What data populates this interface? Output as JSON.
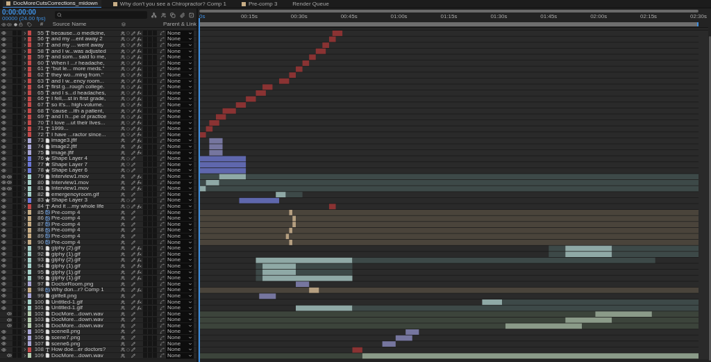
{
  "tabs": [
    {
      "label": "DocMoreCutsCorrections_midown",
      "selected": true
    },
    {
      "label": "Why don't you see a Chiropractor? Comp 1",
      "selected": false
    },
    {
      "label": "Pre-comp 3",
      "selected": false
    },
    {
      "label": "Render Queue",
      "selected": false
    }
  ],
  "timecode": "0:00:00:00",
  "frame_info": "00000 (24.00 fps)",
  "columns": {
    "number": "#",
    "name": "Source Name",
    "parent": "Parent & Link"
  },
  "ruler": [
    "0s",
    "00:15s",
    "00:30s",
    "00:45s",
    "01:00s",
    "01:15s",
    "01:30s",
    "01:45s",
    "02:00s",
    "02:15s",
    "02:30s"
  ],
  "layers": [
    {
      "num": "55",
      "name": "because...o medicine,",
      "kind": "text",
      "color": "#c44a4a",
      "video": true,
      "audio": false,
      "fx": true,
      "parent": "None"
    },
    {
      "num": "56",
      "name": "and my ...ent away 2",
      "kind": "text",
      "color": "#c44a4a",
      "video": true,
      "audio": false,
      "fx": true,
      "parent": "None"
    },
    {
      "num": "57",
      "name": "and my ... went away",
      "kind": "text",
      "color": "#c44a4a",
      "video": true,
      "audio": false,
      "fx": true,
      "parent": "None"
    },
    {
      "num": "58",
      "name": "and I w...was adjusted",
      "kind": "text",
      "color": "#c44a4a",
      "video": true,
      "audio": false,
      "fx": true,
      "parent": "None"
    },
    {
      "num": "59",
      "name": "and som... said to me,",
      "kind": "text",
      "color": "#c44a4a",
      "video": true,
      "audio": false,
      "fx": true,
      "parent": "None"
    },
    {
      "num": "60",
      "name": "When I ...r headache,",
      "kind": "text",
      "color": "#c44a4a",
      "video": true,
      "audio": false,
      "fx": true,
      "parent": "None"
    },
    {
      "num": "61",
      "name": "\"but le... more meds.\"",
      "kind": "text",
      "color": "#c44a4a",
      "video": true,
      "audio": false,
      "fx": true,
      "parent": "None"
    },
    {
      "num": "62",
      "name": "they wo...ming from.\"",
      "kind": "text",
      "color": "#c44a4a",
      "video": true,
      "audio": false,
      "fx": true,
      "parent": "None"
    },
    {
      "num": "63",
      "name": "and I w...ency room...",
      "kind": "text",
      "color": "#c44a4a",
      "video": true,
      "audio": false,
      "fx": true,
      "parent": "None"
    },
    {
      "num": "64",
      "name": "first g...rough college.",
      "kind": "text",
      "color": "#c44a4a",
      "video": true,
      "audio": false,
      "fx": true,
      "parent": "None"
    },
    {
      "num": "65",
      "name": "and I s...d headaches,",
      "kind": "text",
      "color": "#c44a4a",
      "video": true,
      "audio": false,
      "fx": true,
      "parent": "None"
    },
    {
      "num": "66",
      "name": "I fell,...st in first grade,",
      "kind": "text",
      "color": "#c44a4a",
      "video": true,
      "audio": false,
      "fx": true,
      "parent": "None"
    },
    {
      "num": "67",
      "name": "so it's... high-volume.",
      "kind": "text",
      "color": "#c44a4a",
      "video": true,
      "audio": false,
      "fx": true,
      "parent": "None"
    },
    {
      "num": "68",
      "name": "'cause ...ith a patient,",
      "kind": "text",
      "color": "#c44a4a",
      "video": true,
      "audio": false,
      "fx": true,
      "parent": "None"
    },
    {
      "num": "69",
      "name": "and I h...pe of practice",
      "kind": "text",
      "color": "#c44a4a",
      "video": true,
      "audio": false,
      "fx": true,
      "parent": "None"
    },
    {
      "num": "70",
      "name": "I love ...ut their lives...",
      "kind": "text",
      "color": "#c44a4a",
      "video": true,
      "audio": false,
      "fx": true,
      "parent": "None"
    },
    {
      "num": "71",
      "name": "1999...",
      "kind": "text",
      "color": "#c44a4a",
      "video": true,
      "audio": false,
      "fx": true,
      "parent": "None"
    },
    {
      "num": "72",
      "name": "I have ...ractor since...",
      "kind": "text",
      "color": "#c44a4a",
      "video": true,
      "audio": false,
      "fx": true,
      "parent": "None"
    },
    {
      "num": "73",
      "name": "image3.jfif",
      "kind": "image",
      "color": "#a9a6d6",
      "video": true,
      "audio": false,
      "fx": true,
      "parent": "None"
    },
    {
      "num": "74",
      "name": "image2.jfif",
      "kind": "image",
      "color": "#a9a6d6",
      "video": true,
      "audio": false,
      "fx": true,
      "parent": "None"
    },
    {
      "num": "75",
      "name": "image.jfif",
      "kind": "image",
      "color": "#a9a6d6",
      "video": true,
      "audio": false,
      "fx": true,
      "parent": "None"
    },
    {
      "num": "76",
      "name": "Shape Layer 4",
      "kind": "shape",
      "color": "#6c79d8",
      "video": true,
      "audio": false,
      "fx": false,
      "parent": "None"
    },
    {
      "num": "77",
      "name": "Shape Layer 7",
      "kind": "shape",
      "color": "#6c79d8",
      "video": true,
      "audio": false,
      "fx": false,
      "parent": "None"
    },
    {
      "num": "78",
      "name": "Shape Layer 6",
      "kind": "shape",
      "color": "#6c79d8",
      "video": true,
      "audio": false,
      "fx": false,
      "parent": "None"
    },
    {
      "num": "79",
      "name": "Interview1.mov",
      "kind": "footage",
      "color": "#a6d3cb",
      "video": true,
      "audio": true,
      "fx": true,
      "parent": "None"
    },
    {
      "num": "80",
      "name": "Interview1.mov",
      "kind": "footage",
      "color": "#a6d3cb",
      "video": true,
      "audio": true,
      "fx": true,
      "parent": "None"
    },
    {
      "num": "81",
      "name": "Interview1.mov",
      "kind": "footage",
      "color": "#a6d3cb",
      "video": true,
      "audio": true,
      "fx": true,
      "parent": "None"
    },
    {
      "num": "82",
      "name": "emergencyroom.gif",
      "kind": "footage",
      "color": "#a6d3cb",
      "video": true,
      "audio": false,
      "fx": false,
      "parent": "None"
    },
    {
      "num": "83",
      "name": "Shape Layer 3",
      "kind": "shape",
      "color": "#6c79d8",
      "video": true,
      "audio": false,
      "fx": false,
      "parent": "None"
    },
    {
      "num": "84",
      "name": "And it ...my whole life",
      "kind": "text",
      "color": "#c44a4a",
      "video": true,
      "audio": false,
      "fx": true,
      "parent": "None"
    },
    {
      "num": "85",
      "name": "Pre-comp 4",
      "kind": "precomp",
      "color": "#c8ae86",
      "video": true,
      "audio": false,
      "fx": false,
      "parent": "None"
    },
    {
      "num": "86",
      "name": "Pre-comp 4",
      "kind": "precomp",
      "color": "#c8ae86",
      "video": true,
      "audio": false,
      "fx": false,
      "parent": "None"
    },
    {
      "num": "87",
      "name": "Pre-comp 4",
      "kind": "precomp",
      "color": "#c8ae86",
      "video": true,
      "audio": false,
      "fx": false,
      "parent": "None"
    },
    {
      "num": "88",
      "name": "Pre-comp 4",
      "kind": "precomp",
      "color": "#c8ae86",
      "video": true,
      "audio": false,
      "fx": false,
      "parent": "None"
    },
    {
      "num": "89",
      "name": "Pre-comp 4",
      "kind": "precomp",
      "color": "#c8ae86",
      "video": true,
      "audio": false,
      "fx": false,
      "parent": "None"
    },
    {
      "num": "90",
      "name": "Pre-comp 4",
      "kind": "precomp",
      "color": "#c8ae86",
      "video": true,
      "audio": false,
      "fx": false,
      "parent": "None"
    },
    {
      "num": "91",
      "name": "giphy (2).gif",
      "kind": "footage",
      "color": "#a6d3cb",
      "video": true,
      "audio": false,
      "fx": true,
      "parent": "None"
    },
    {
      "num": "92",
      "name": "giphy (1).gif",
      "kind": "footage",
      "color": "#a6d3cb",
      "video": true,
      "audio": false,
      "fx": true,
      "parent": "None"
    },
    {
      "num": "93",
      "name": "giphy (2).gif",
      "kind": "footage",
      "color": "#a6d3cb",
      "video": true,
      "audio": false,
      "fx": true,
      "parent": "None"
    },
    {
      "num": "94",
      "name": "giphy (1).gif",
      "kind": "footage",
      "color": "#a6d3cb",
      "video": true,
      "audio": false,
      "fx": true,
      "parent": "None"
    },
    {
      "num": "95",
      "name": "giphy (1).gif",
      "kind": "footage",
      "color": "#a6d3cb",
      "video": true,
      "audio": false,
      "fx": true,
      "parent": "None"
    },
    {
      "num": "96",
      "name": "giphy (1).gif",
      "kind": "footage",
      "color": "#a6d3cb",
      "video": true,
      "audio": false,
      "fx": true,
      "parent": "None"
    },
    {
      "num": "97",
      "name": "DoctorRoom.png",
      "kind": "image",
      "color": "#a9a6d6",
      "video": true,
      "audio": false,
      "fx": false,
      "parent": "None"
    },
    {
      "num": "98",
      "name": "Why don...r? Comp 1",
      "kind": "precomp",
      "color": "#c8ae86",
      "video": true,
      "audio": false,
      "fx": true,
      "parent": "None"
    },
    {
      "num": "99",
      "name": "girlfell.png",
      "kind": "image",
      "color": "#a9a6d6",
      "video": true,
      "audio": false,
      "fx": false,
      "parent": "None"
    },
    {
      "num": "100",
      "name": "Untitled-1.gif",
      "kind": "footage",
      "color": "#a6d3cb",
      "video": true,
      "audio": false,
      "fx": true,
      "parent": "None"
    },
    {
      "num": "101",
      "name": "Untitled-1.gif",
      "kind": "footage",
      "color": "#a6d3cb",
      "video": true,
      "audio": false,
      "fx": true,
      "parent": "None"
    },
    {
      "num": "102",
      "name": "DocMore...down.wav",
      "kind": "audio",
      "color": "#b5cdb0",
      "video": false,
      "audio": true,
      "fx": false,
      "parent": "None"
    },
    {
      "num": "103",
      "name": "DocMore...down.wav",
      "kind": "audio",
      "color": "#b5cdb0",
      "video": false,
      "audio": true,
      "fx": false,
      "parent": "None"
    },
    {
      "num": "104",
      "name": "DocMore...down.wav",
      "kind": "audio",
      "color": "#b5cdb0",
      "video": false,
      "audio": true,
      "fx": false,
      "parent": "None"
    },
    {
      "num": "105",
      "name": "scene8.png",
      "kind": "image",
      "color": "#a9a6d6",
      "video": true,
      "audio": false,
      "fx": false,
      "parent": "None"
    },
    {
      "num": "106",
      "name": "scene7.png",
      "kind": "image",
      "color": "#a9a6d6",
      "video": true,
      "audio": false,
      "fx": false,
      "parent": "None"
    },
    {
      "num": "107",
      "name": "scene6.png",
      "kind": "image",
      "color": "#a9a6d6",
      "video": true,
      "audio": false,
      "fx": false,
      "parent": "None"
    },
    {
      "num": "108",
      "name": "How doe...er doctors?",
      "kind": "text",
      "color": "#c44a4a",
      "video": true,
      "audio": false,
      "fx": false,
      "parent": "None"
    },
    {
      "num": "109",
      "name": "DocMore...down.wav",
      "kind": "audio",
      "color": "#b5cdb0",
      "video": false,
      "audio": true,
      "fx": false,
      "parent": "None"
    }
  ]
}
